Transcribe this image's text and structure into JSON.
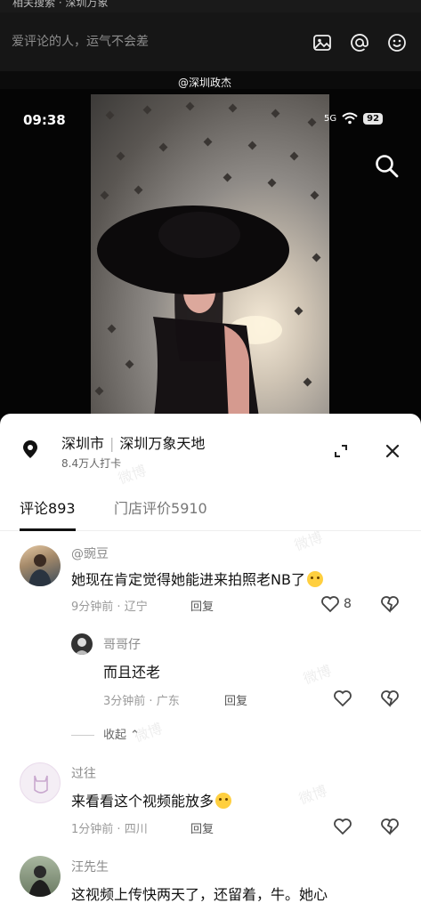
{
  "top_strip": {
    "partial_text": "相关搜索 · 深圳万象"
  },
  "comment_bar": {
    "placeholder": "爱评论的人，运气不会差",
    "icons": [
      "image-icon",
      "at-icon",
      "emoji-icon"
    ]
  },
  "watermark": "@深圳政杰",
  "status_bar": {
    "time": "09:38",
    "signal": "5G",
    "battery": "92"
  },
  "location": {
    "city": "深圳市",
    "place": "深圳万象天地",
    "checkins": "8.4万人打卡"
  },
  "tabs": [
    {
      "label": "评论",
      "count": "893"
    },
    {
      "label": "门店评价",
      "count": "5910"
    }
  ],
  "comments": [
    {
      "user": "@豌豆",
      "text": "她现在肯定觉得她能进来拍照老NB了",
      "time": "9分钟前",
      "region": "辽宁",
      "reply_label": "回复",
      "likes": "8",
      "replies": [
        {
          "user": "哥哥仔",
          "text": "而且还老",
          "time": "3分钟前",
          "region": "广东",
          "reply_label": "回复"
        }
      ],
      "collapse_label": "收起"
    },
    {
      "user": "过往",
      "text": "来看看这个视频能放多",
      "time": "1分钟前",
      "region": "四川",
      "reply_label": "回复"
    },
    {
      "user": "汪先生",
      "text": "这视频上传快两天了，还留着，牛。她心"
    }
  ],
  "colors": {
    "panel_bg": "#ffffff",
    "dark_bg": "#0b0b0b",
    "text_primary": "#111111",
    "text_secondary": "#9a9a9a"
  }
}
